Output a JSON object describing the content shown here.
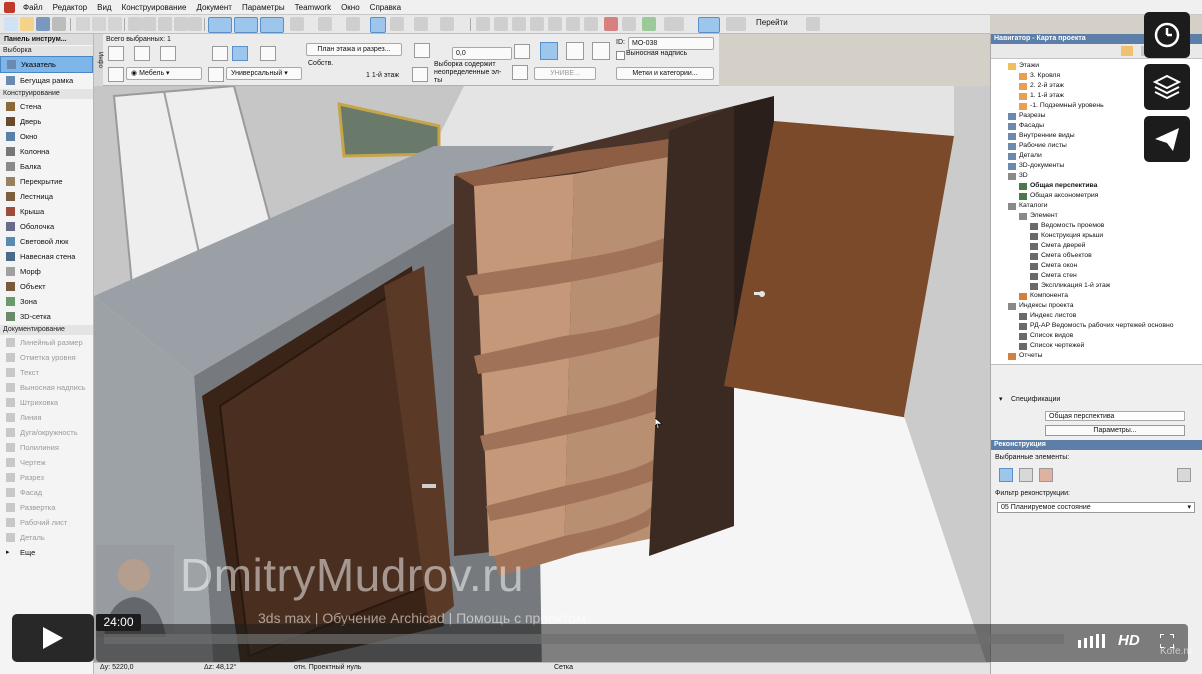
{
  "menu": [
    "Файл",
    "Редактор",
    "Вид",
    "Конструирование",
    "Документ",
    "Параметры",
    "Teamwork",
    "Окно",
    "Справка"
  ],
  "toolbar": {
    "goto_label": "Перейти"
  },
  "toolbox": {
    "title": "Панель инструм...",
    "selection_header": "Выборка",
    "items_select": [
      {
        "label": "Указатель",
        "icon": "arrow-icon",
        "active": true
      },
      {
        "label": "Бегущая рамка",
        "icon": "marquee-icon",
        "active": false
      }
    ],
    "construction_header": "Конструирование",
    "items_construction": [
      {
        "label": "Стена",
        "icon": "wall-icon",
        "color": "#8a6a3a"
      },
      {
        "label": "Дверь",
        "icon": "door-icon",
        "color": "#6a4a2a"
      },
      {
        "label": "Окно",
        "icon": "window-icon",
        "color": "#5a7fa8"
      },
      {
        "label": "Колонна",
        "icon": "column-icon",
        "color": "#777777"
      },
      {
        "label": "Балка",
        "icon": "beam-icon",
        "color": "#8a8a8a"
      },
      {
        "label": "Перекрытие",
        "icon": "slab-icon",
        "color": "#9a8060"
      },
      {
        "label": "Лестница",
        "icon": "stair-icon",
        "color": "#7a6040"
      },
      {
        "label": "Крыша",
        "icon": "roof-icon",
        "color": "#a04a3a"
      },
      {
        "label": "Оболочка",
        "icon": "shell-icon",
        "color": "#6a6a8a"
      },
      {
        "label": "Световой люк",
        "icon": "skylight-icon",
        "color": "#5a8ab0"
      },
      {
        "label": "Навесная стена",
        "icon": "curtain-wall-icon",
        "color": "#4a6a8a"
      },
      {
        "label": "Морф",
        "icon": "morph-icon",
        "color": "#a0a0a0"
      },
      {
        "label": "Объект",
        "icon": "object-icon",
        "color": "#7a5a3a"
      },
      {
        "label": "Зона",
        "icon": "zone-icon",
        "color": "#6a9a6a"
      },
      {
        "label": "3D-сетка",
        "icon": "mesh-icon",
        "color": "#6a8a6a"
      }
    ],
    "documentation_header": "Документирование",
    "items_documentation": [
      {
        "label": "Линейный размер",
        "icon": "dimension-icon"
      },
      {
        "label": "Отметка уровня",
        "icon": "level-icon"
      },
      {
        "label": "Текст",
        "icon": "text-icon"
      },
      {
        "label": "Выносная надпись",
        "icon": "label-icon"
      },
      {
        "label": "Штриховка",
        "icon": "fill-icon"
      },
      {
        "label": "Линия",
        "icon": "line-icon"
      },
      {
        "label": "Дуга/окружность",
        "icon": "arc-icon"
      },
      {
        "label": "Полилиния",
        "icon": "polyline-icon"
      },
      {
        "label": "Чертеж",
        "icon": "drawing-icon"
      },
      {
        "label": "Разрез",
        "icon": "section-icon"
      },
      {
        "label": "Фасад",
        "icon": "elevation-icon"
      },
      {
        "label": "Развертка",
        "icon": "interior-icon"
      },
      {
        "label": "Рабочий лист",
        "icon": "worksheet-icon"
      },
      {
        "label": "Деталь",
        "icon": "detail-icon"
      }
    ],
    "more": "Еще"
  },
  "infobox": {
    "side_label": "Инфо",
    "selected_count": "Всего выбранных: 1",
    "floor_plan_btn": "План этажа и разрез...",
    "angle_value": "0,0",
    "id_label": "ID:",
    "id_value": "MO-038",
    "callout_label": "Выносная надпись",
    "layer_value": "Мебель",
    "profile_value": "Универсальный",
    "story_label": "Собств.",
    "story_value": "1   1-й этаж",
    "selection_note": "Выборка содержит неопределенные эл-ты",
    "disabled_btn": "УНИВЕ...",
    "tags_btn": "Метки и категории..."
  },
  "watermark": {
    "main": "DmitryMudrov.ru",
    "sub": "3ds max | Обучение Archicad | Помощь с проектом"
  },
  "navigator": {
    "title": "Навигатор - Карта проекта",
    "tree": [
      {
        "label": "Этажи",
        "indent": 1,
        "icon": "folder-icon",
        "bold": false
      },
      {
        "label": "3. Кровля",
        "indent": 2,
        "icon": "story-icon",
        "bold": false
      },
      {
        "label": "2. 2-й этаж",
        "indent": 2,
        "icon": "story-icon",
        "bold": false
      },
      {
        "label": "1. 1-й этаж",
        "indent": 2,
        "icon": "story-icon",
        "bold": false
      },
      {
        "label": "-1. Подземный уровень",
        "indent": 2,
        "icon": "story-icon",
        "bold": false
      },
      {
        "label": "Разрезы",
        "indent": 1,
        "icon": "section-icon",
        "bold": false
      },
      {
        "label": "Фасады",
        "indent": 1,
        "icon": "elevation-icon",
        "bold": false
      },
      {
        "label": "Внутренние виды",
        "indent": 1,
        "icon": "interior-icon",
        "bold": false
      },
      {
        "label": "Рабочие листы",
        "indent": 1,
        "icon": "worksheet-icon",
        "bold": false
      },
      {
        "label": "Детали",
        "indent": 1,
        "icon": "detail-icon",
        "bold": false
      },
      {
        "label": "3D-документы",
        "indent": 1,
        "icon": "doc3d-icon",
        "bold": false
      },
      {
        "label": "3D",
        "indent": 1,
        "icon": "cube-icon",
        "bold": false
      },
      {
        "label": "Общая перспектива",
        "indent": 2,
        "icon": "perspective-icon",
        "bold": true
      },
      {
        "label": "Общая аксонометрия",
        "indent": 2,
        "icon": "axon-icon",
        "bold": false
      },
      {
        "label": "Каталоги",
        "indent": 1,
        "icon": "catalog-icon",
        "bold": false
      },
      {
        "label": "Элемент",
        "indent": 2,
        "icon": "element-icon",
        "bold": false
      },
      {
        "label": "Ведомость проемов",
        "indent": 3,
        "icon": "list-icon",
        "bold": false
      },
      {
        "label": "Конструкция крыши",
        "indent": 3,
        "icon": "list-icon",
        "bold": false
      },
      {
        "label": "Смета дверей",
        "indent": 3,
        "icon": "list-icon",
        "bold": false
      },
      {
        "label": "Смета объектов",
        "indent": 3,
        "icon": "list-icon",
        "bold": false
      },
      {
        "label": "Смета окон",
        "indent": 3,
        "icon": "list-icon",
        "bold": false
      },
      {
        "label": "Смета стен",
        "indent": 3,
        "icon": "list-icon",
        "bold": false
      },
      {
        "label": "Экспликация 1-й этаж",
        "indent": 3,
        "icon": "list-icon",
        "bold": false
      },
      {
        "label": "Компонента",
        "indent": 2,
        "icon": "component-icon",
        "bold": false
      },
      {
        "label": "Индексы проекта",
        "indent": 1,
        "icon": "index-icon",
        "bold": false
      },
      {
        "label": "Индекс листов",
        "indent": 2,
        "icon": "list-icon",
        "bold": false
      },
      {
        "label": "РД-АР Ведомость рабочих чертежей основно",
        "indent": 2,
        "icon": "list-icon",
        "bold": false
      },
      {
        "label": "Список видов",
        "indent": 2,
        "icon": "list-icon",
        "bold": false
      },
      {
        "label": "Список чертежей",
        "indent": 2,
        "icon": "list-icon",
        "bold": false
      },
      {
        "label": "Отчеты",
        "indent": 1,
        "icon": "report-icon",
        "bold": false
      }
    ]
  },
  "specs": {
    "header": "Спецификации",
    "view_value": "Общая перспектива",
    "params_btn": "Параметры..."
  },
  "reconstruction": {
    "title": "Реконструкция",
    "selected_label": "Выбранные элементы:",
    "filter_label": "Фильтр реконструкции:",
    "filter_value": "05 Планируемое состояние"
  },
  "statusbar": {
    "a": "Δу: 5220,0",
    "b": "Δz: 48,12°",
    "c": "отн. Проектный нуль",
    "d": "Сетка"
  },
  "player": {
    "time": "24:00",
    "hd": "HD"
  },
  "site_mark": "Kofe.ru",
  "colors": {
    "accent": "#5b7fa8",
    "selected": "#7fb6ea",
    "wall": "#7a7a7a",
    "floor": "#f4f4f4",
    "door": "#3a2418",
    "wood": "#8c6446"
  }
}
